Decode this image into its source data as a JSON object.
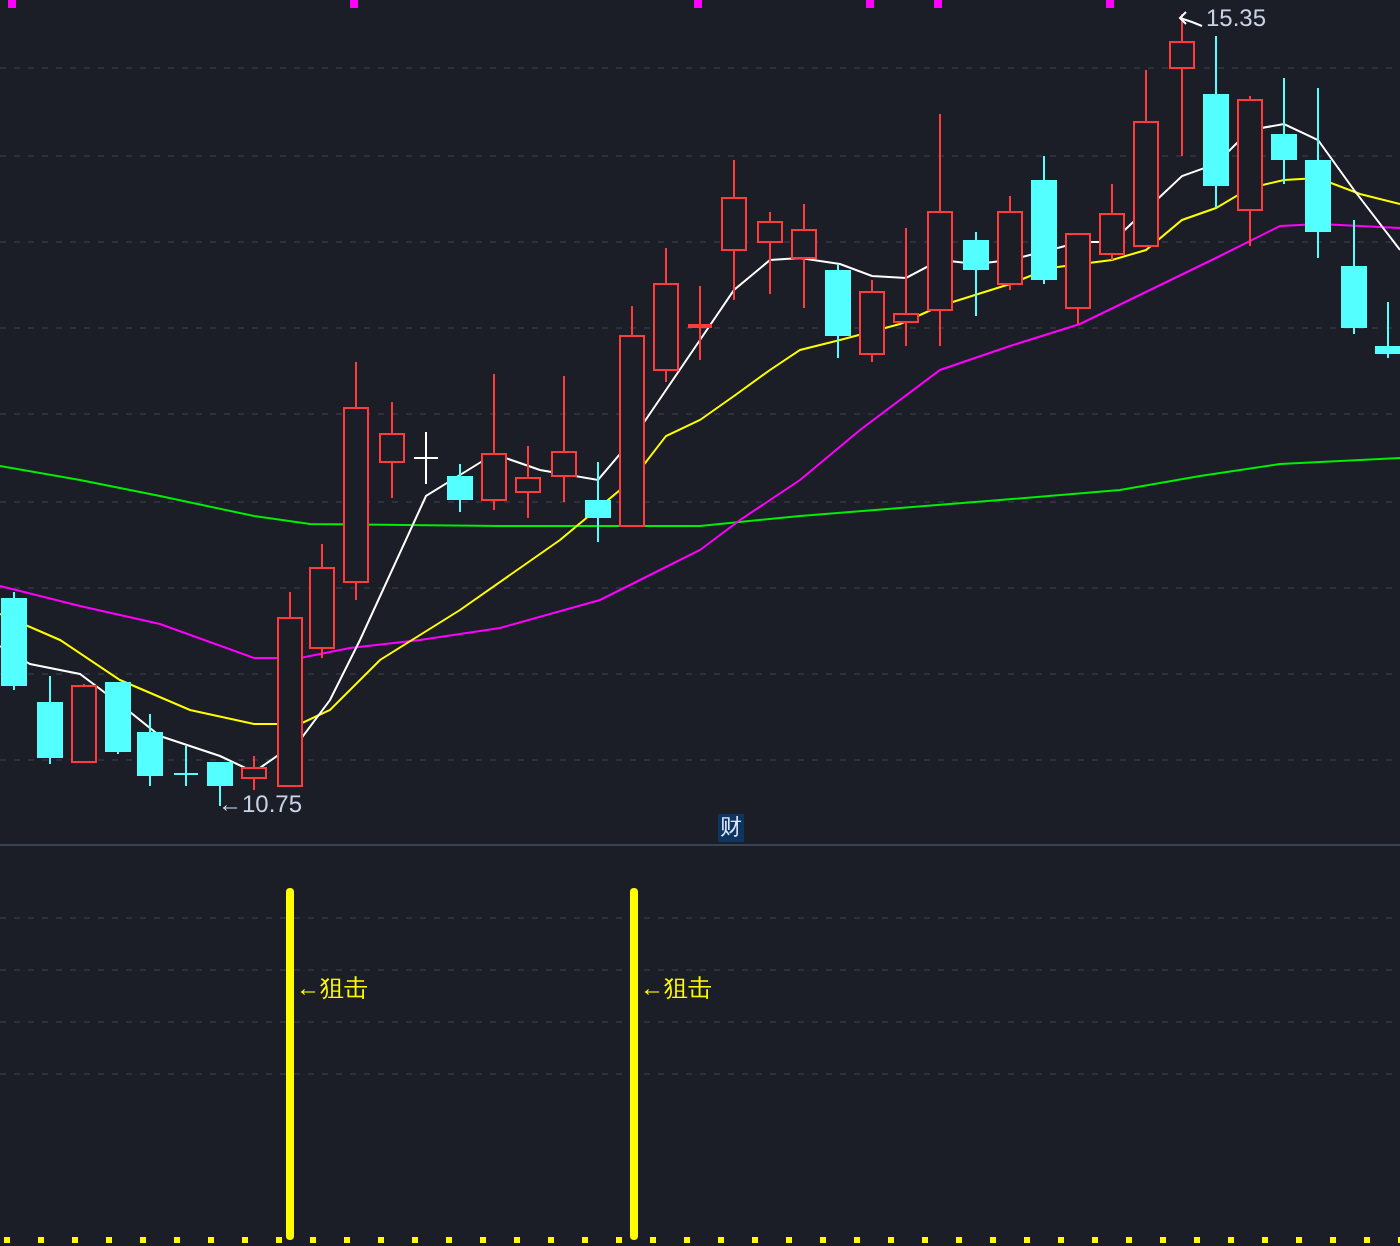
{
  "price_chart": {
    "high_label": "15.35",
    "low_label": "←10.75",
    "marker": "财"
  },
  "indicator_panel": {
    "signals": [
      {
        "label": "←狙击"
      },
      {
        "label": "←狙击"
      }
    ]
  }
}
